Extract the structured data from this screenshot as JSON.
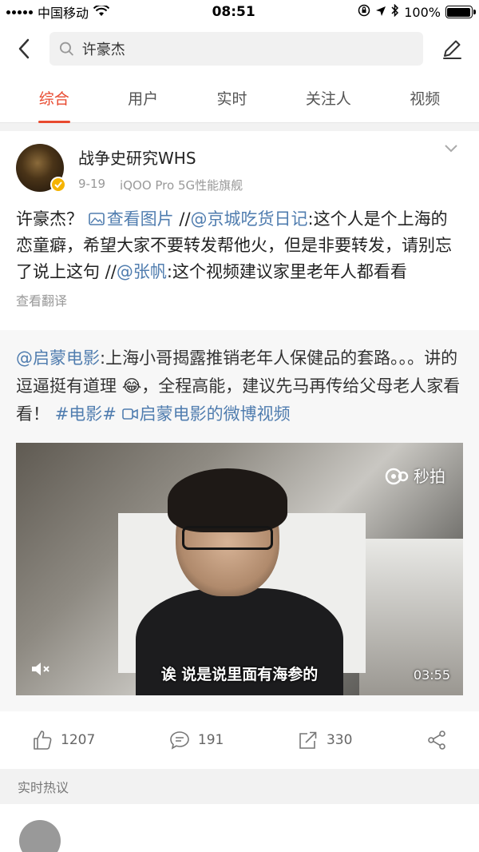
{
  "status_bar": {
    "carrier": "中国移动",
    "time": "08:51",
    "battery": "100%",
    "battery_level": 1.0
  },
  "search": {
    "query": "许豪杰"
  },
  "tabs": [
    {
      "label": "综合",
      "active": true
    },
    {
      "label": "用户",
      "active": false
    },
    {
      "label": "实时",
      "active": false
    },
    {
      "label": "关注人",
      "active": false
    },
    {
      "label": "视频",
      "active": false
    }
  ],
  "post": {
    "author": "战争史研究WHS",
    "date": "9-19",
    "device": "iQOO Pro 5G性能旗舰",
    "text": {
      "t1": "许豪杰？ ",
      "image_link": "查看图片",
      "t2": " //",
      "mention1": "@京城吃货日记",
      "t3": ":这个人是个上海的恋童癖，希望大家不要转发帮他火，但是非要转发，请别忘了说上这句 //",
      "mention2": "@张帆",
      "t4": ":这个视频建议家里老年人都看看"
    },
    "translate": "查看翻译"
  },
  "repost": {
    "mention": "@启蒙电影",
    "t1": ":上海小哥揭露推销老年人保健品的套路。。。讲的逗逼挺有道理 ",
    "emoji": "😂",
    "t2": "，全程高能，建议先马再传给父母老人家看看！ ",
    "hashtag": "#电影#",
    "video_link": "启蒙电影的微博视频",
    "video": {
      "caption": "诶 说是说里面有海参的",
      "watermark": "秒拍",
      "duration": "03:55"
    }
  },
  "actions": {
    "likes": "1207",
    "comments": "191",
    "reposts": "330"
  },
  "section": {
    "hot_title": "实时热议"
  },
  "colors": {
    "accent": "#e8492f",
    "link": "#507daf"
  }
}
